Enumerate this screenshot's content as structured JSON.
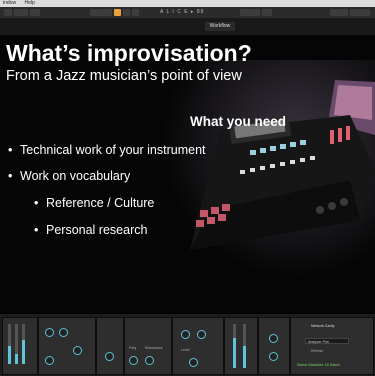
{
  "menubar": {
    "items": [
      "indow",
      "Help"
    ]
  },
  "transport": {
    "title": "A L I C E   ▸   89"
  },
  "tabs": {
    "active": "Workflow"
  },
  "slide": {
    "title": "What’s improvisation?",
    "subtitle": "From a Jazz musician’s point of view",
    "heading": "What you need",
    "bullets": [
      {
        "text": "Technical work of your instrument",
        "level": 1
      },
      {
        "text": "Work on vocabulary",
        "level": 1
      },
      {
        "text": "Reference / Culture",
        "level": 2
      },
      {
        "text": "Personal research",
        "level": 2
      }
    ],
    "bullet_glyph": "•"
  },
  "devices": {
    "labels": {
      "network_cavity": "Network Cavity",
      "dropdown": "Analyzer Plot",
      "refresh": "Refresh",
      "footer": "Noise Machine 16 Band",
      "ch1": "Freq",
      "ch2": "Resonance",
      "ch3": "Level"
    }
  },
  "colors": {
    "accent": "#5fc3d9",
    "transport_orange": "#e9a23b",
    "device_bg": "#2e2e2e"
  }
}
